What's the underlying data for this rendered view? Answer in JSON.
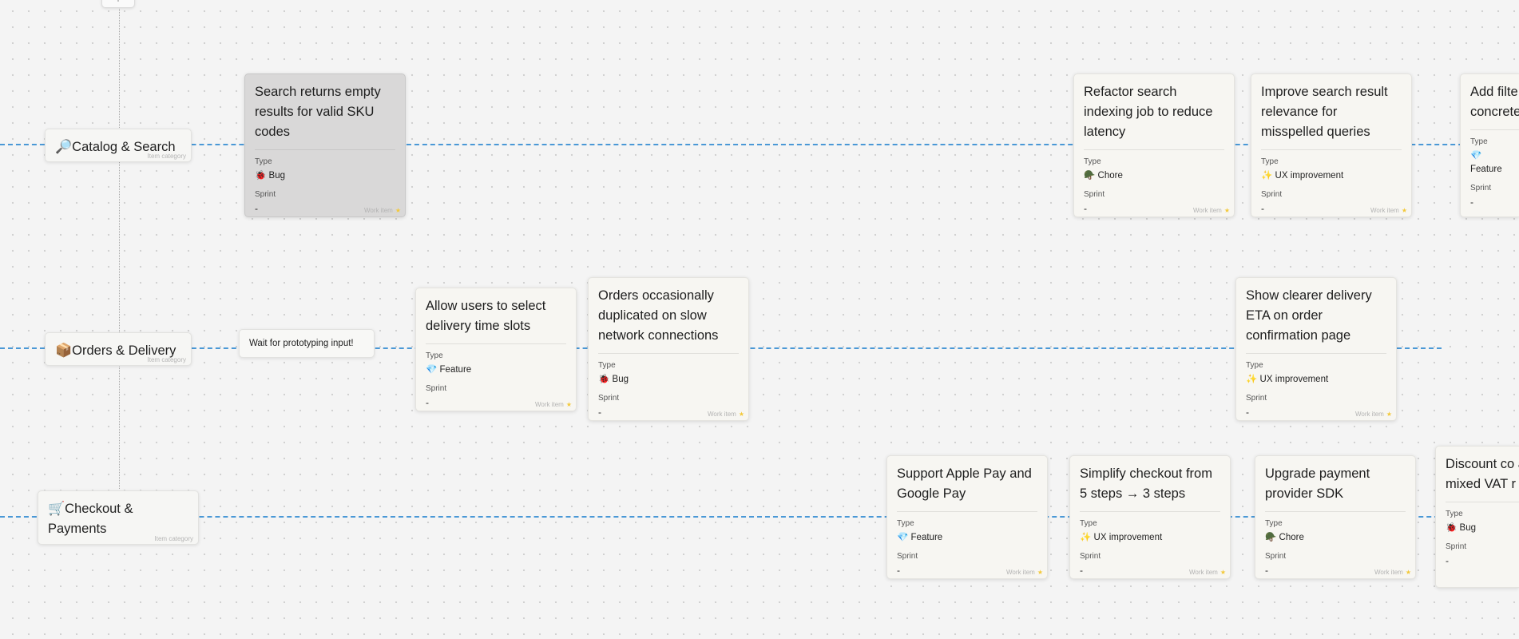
{
  "colors": {
    "swimlane_line": "#4a98d6",
    "selected_card": "#d9d8d8",
    "star": "#f3c93a"
  },
  "toolbar": {
    "expand_label": "+"
  },
  "categories": [
    {
      "emoji": "🔎",
      "name": "Catalog & Search",
      "kind": "Item category"
    },
    {
      "emoji": "📦",
      "name": "Orders & Delivery",
      "kind": "Item category"
    },
    {
      "emoji": "🛒",
      "name": "Checkout & Payments",
      "kind": "Item category"
    }
  ],
  "note": {
    "text": "Wait for prototyping input!"
  },
  "labels": {
    "type": "Type",
    "sprint": "Sprint",
    "footer": "Work item"
  },
  "cards": [
    {
      "title": "Search returns empty results for valid SKU codes",
      "type_icon": "🐞",
      "type": "Bug",
      "sprint": "-"
    },
    {
      "title": "Refactor search indexing job to reduce latency",
      "type_icon": "🪖",
      "type": "Chore",
      "sprint": "-"
    },
    {
      "title": "Improve search result relevance for misspelled queries",
      "type_icon": "✨",
      "type": "UX improvement",
      "sprint": "-"
    },
    {
      "title": "Add filte type (we concrete",
      "type_icon": "💎",
      "type": "Feature",
      "sprint": "-"
    },
    {
      "title": "Allow users to select delivery time slots",
      "type_icon": "💎",
      "type": "Feature",
      "sprint": "-"
    },
    {
      "title": "Orders occasionally duplicated on slow network connections",
      "type_icon": "🐞",
      "type": "Bug",
      "sprint": "-"
    },
    {
      "title": "Show clearer delivery ETA on order confirmation page",
      "type_icon": "✨",
      "type": "UX improvement",
      "sprint": "-"
    },
    {
      "title": "Support Apple Pay and Google Pay",
      "type_icon": "💎",
      "type": "Feature",
      "sprint": "-"
    },
    {
      "title": "Simplify checkout from 5 steps → 3 steps",
      "type_icon": "✨",
      "type": "UX improvement",
      "sprint": "-"
    },
    {
      "title": "Upgrade payment provider SDK",
      "type_icon": "🪖",
      "type": "Chore",
      "sprint": "-"
    },
    {
      "title": "Discount co applied whe mixed VAT r",
      "type_icon": "🐞",
      "type": "Bug",
      "sprint": "-"
    }
  ]
}
